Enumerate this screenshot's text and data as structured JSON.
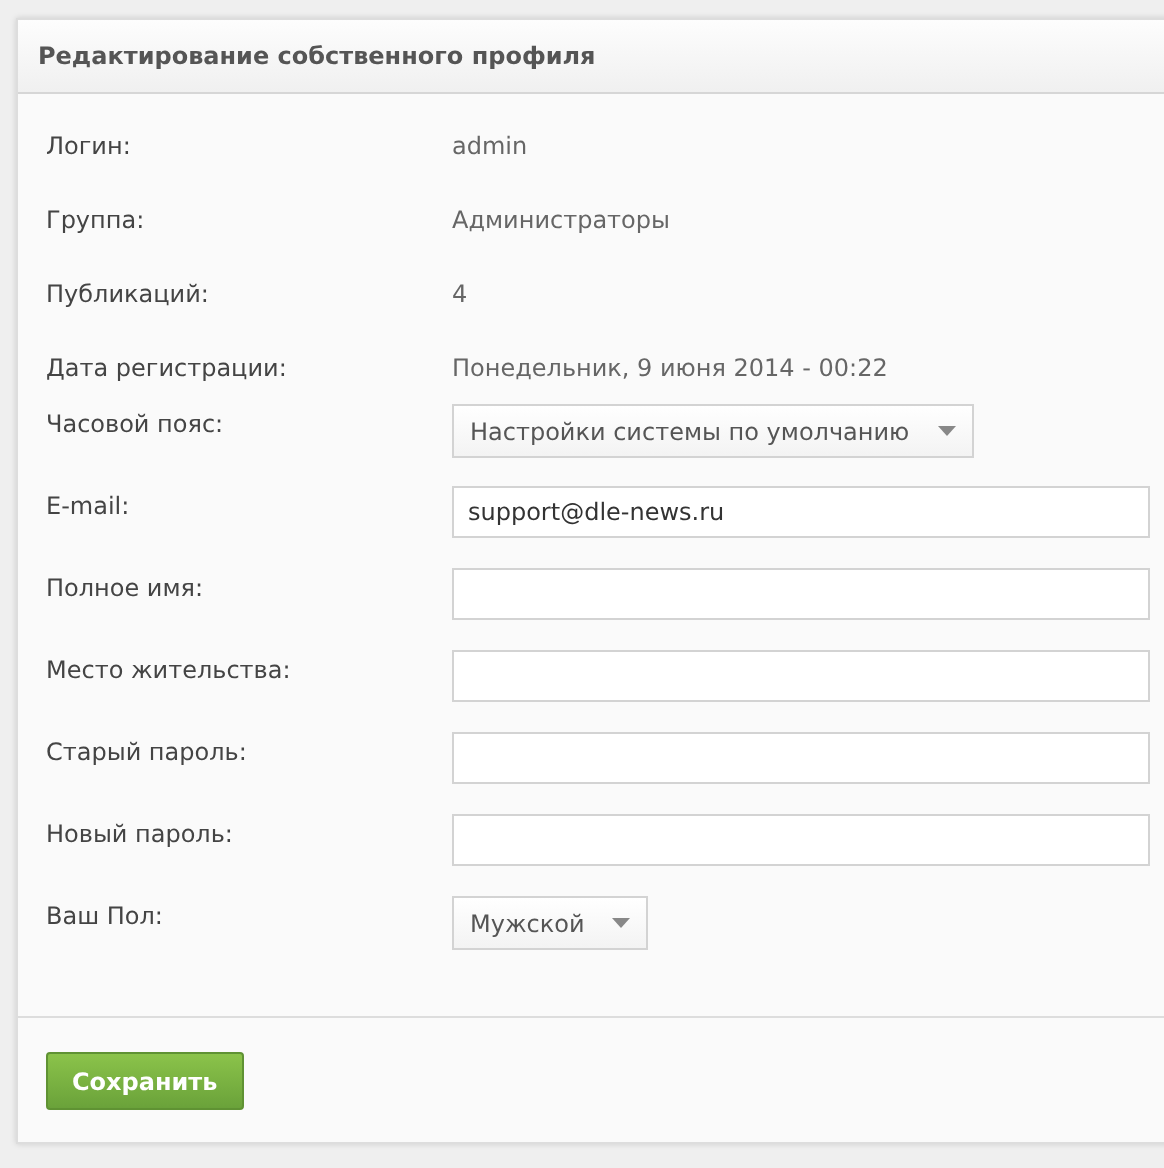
{
  "panel": {
    "title": "Редактирование собственного профиля"
  },
  "rows": [
    {
      "kind": "text",
      "label": "Логин:",
      "value": "admin"
    },
    {
      "kind": "text",
      "label": "Группа:",
      "value": "Администраторы"
    },
    {
      "kind": "text",
      "label": "Публикаций:",
      "value": "4"
    },
    {
      "kind": "text",
      "label": "Дата регистрации:",
      "value": "Понедельник, 9 июня 2014 - 00:22"
    },
    {
      "kind": "select",
      "label": "Часовой пояс:",
      "value": "Настройки системы по умолчанию"
    },
    {
      "kind": "input",
      "label": "E-mail:",
      "value": "support@dle-news.ru"
    },
    {
      "kind": "input",
      "label": "Полное имя:"
    },
    {
      "kind": "input",
      "label": "Место жительства:"
    },
    {
      "kind": "input",
      "label": "Старый пароль:"
    },
    {
      "kind": "input",
      "label": "Новый пароль:"
    },
    {
      "kind": "select",
      "label": "Ваш Пол:",
      "value": "Мужской"
    }
  ],
  "buttons": [
    {
      "label": "Сохранить"
    }
  ]
}
